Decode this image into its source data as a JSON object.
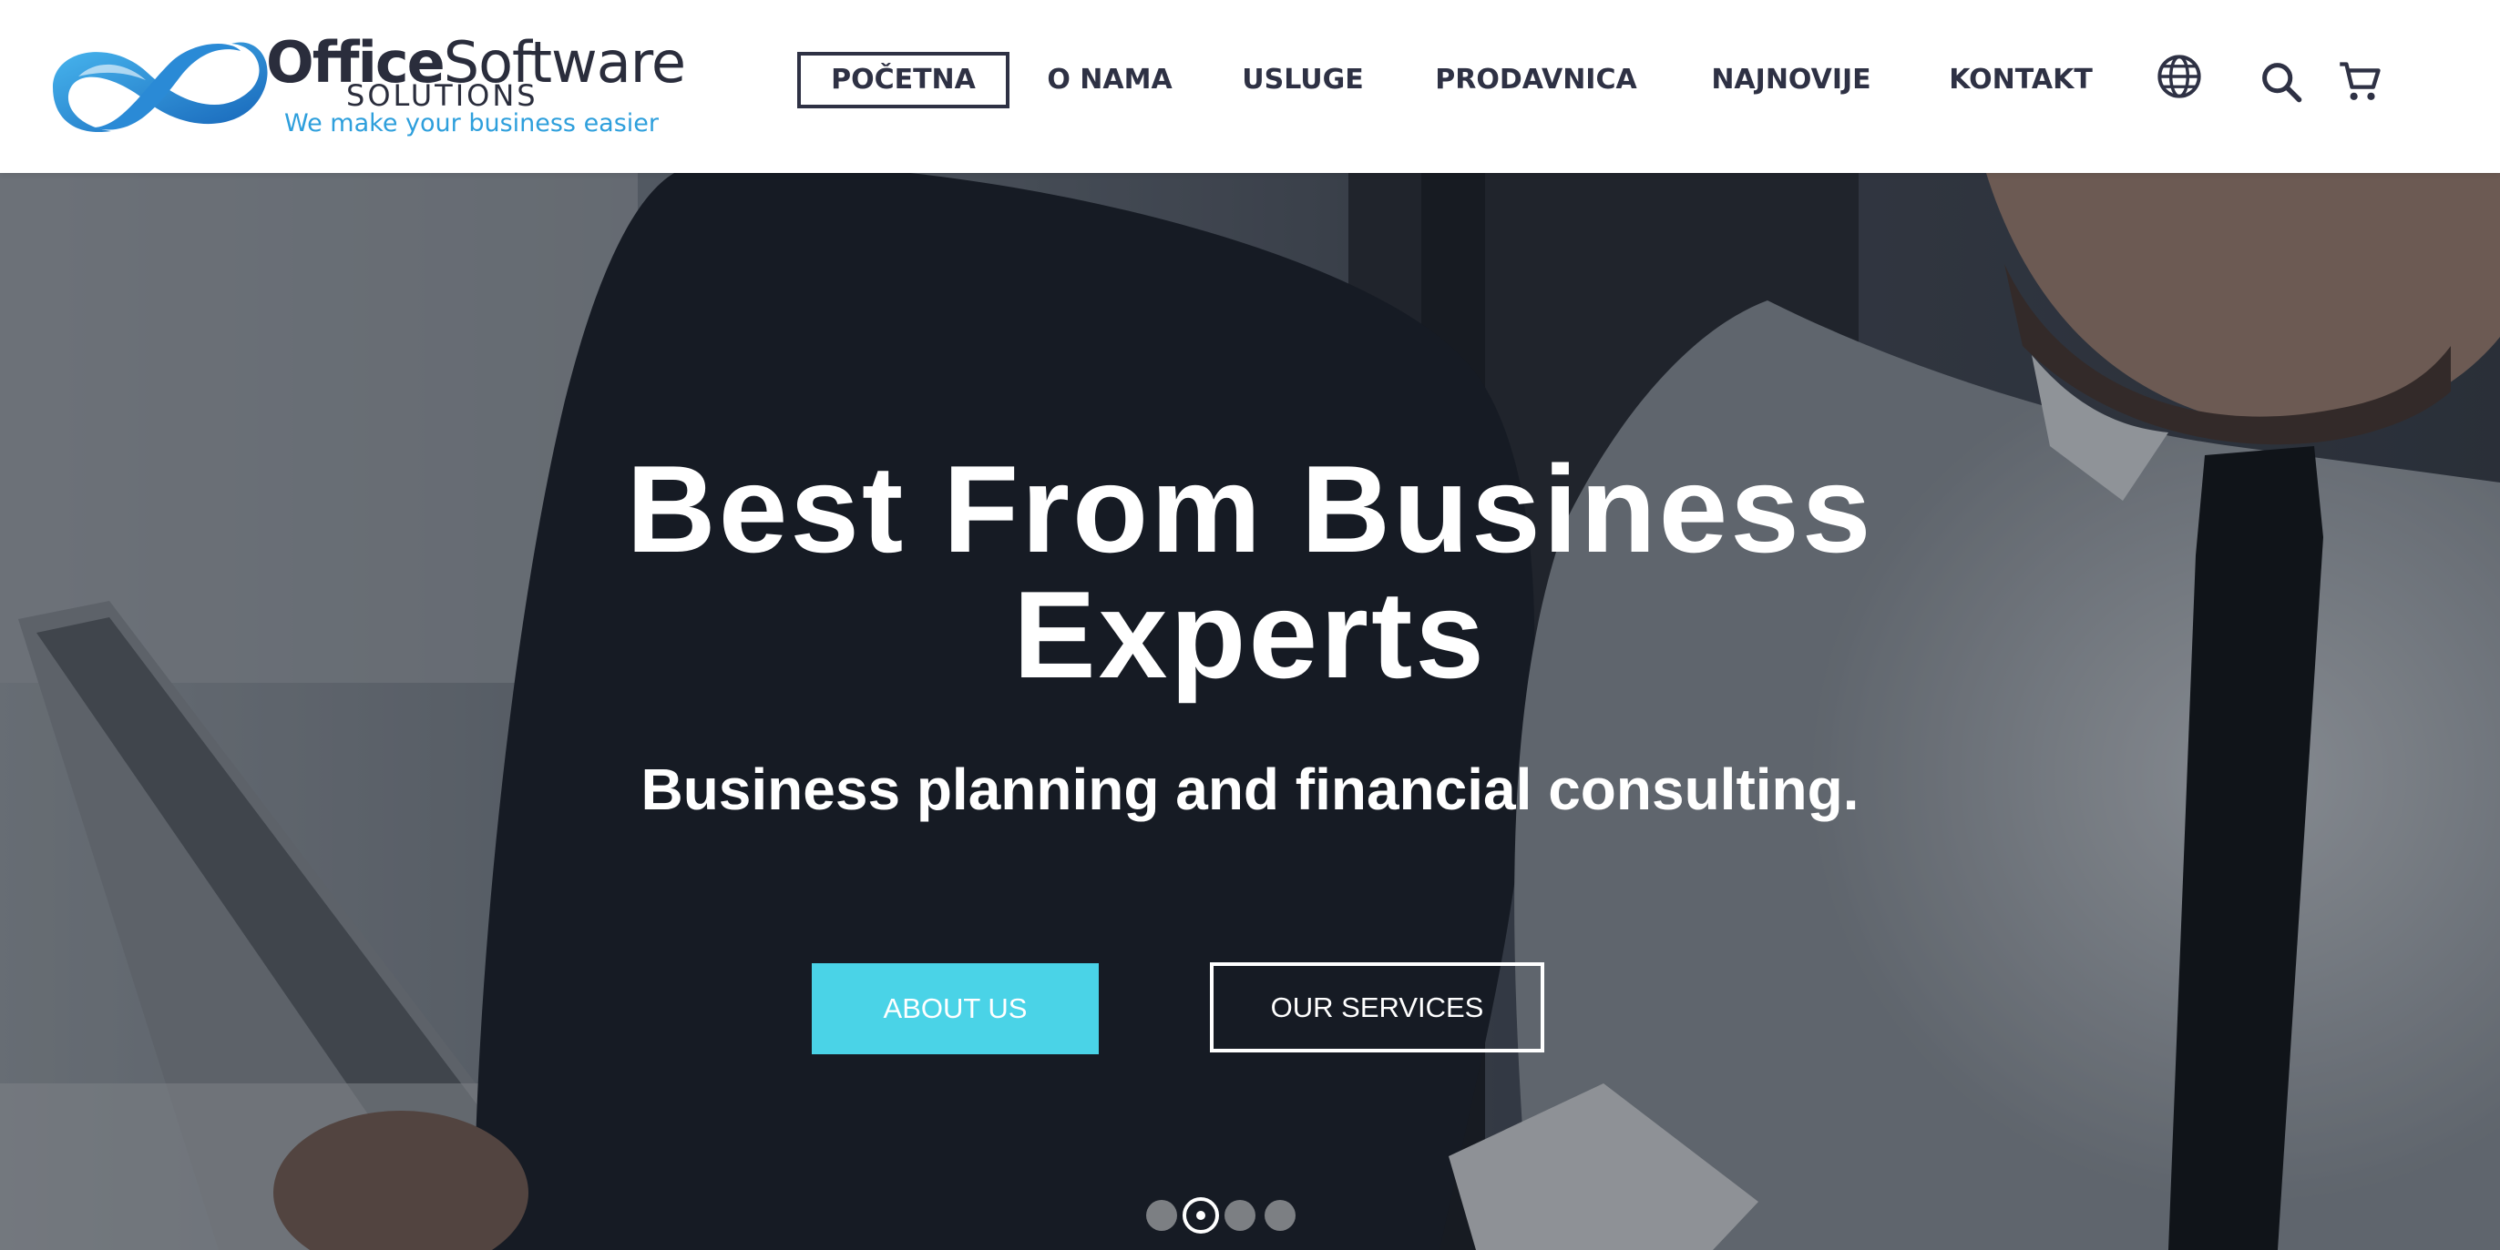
{
  "logo": {
    "name_bold": "Office",
    "name_regular": "Software",
    "subtitle": "SOLUTIONS",
    "tagline": "We make your business easier"
  },
  "nav": {
    "items": [
      {
        "label": "POČETNA",
        "active": true
      },
      {
        "label": "O NAMA"
      },
      {
        "label": "USLUGE"
      },
      {
        "label": "PRODAVNICA"
      },
      {
        "label": "NAJNOVIJE"
      },
      {
        "label": "KONTAKT"
      }
    ],
    "icons": [
      "globe-icon",
      "search-icon",
      "cart-icon"
    ]
  },
  "hero": {
    "title_line1": "Best From Business",
    "title_line2": "Experts",
    "subtitle": "Business planning and financial consulting.",
    "primary_button": "ABOUT US",
    "secondary_button": "OUR SERVICES",
    "slides_total": 4,
    "active_slide": 2
  },
  "colors": {
    "accent": "#4ad3e7",
    "nav_text": "#2e3144",
    "logo_blue": "#2e9fdc"
  }
}
